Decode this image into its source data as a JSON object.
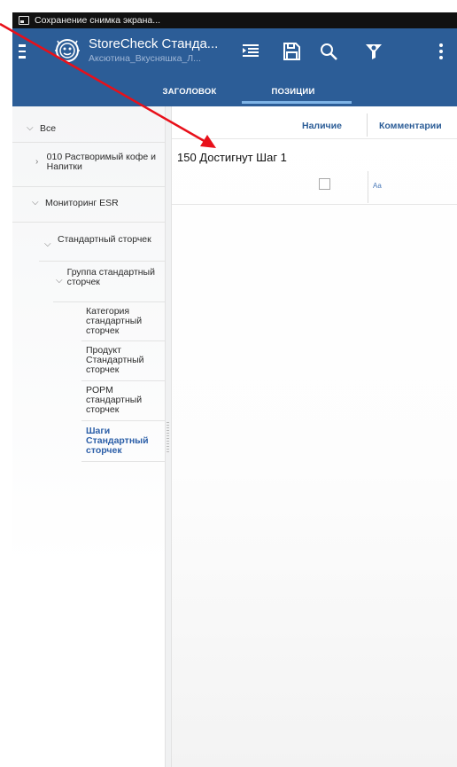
{
  "statusbar": {
    "text": "Сохранение снимка экрана..."
  },
  "appbar": {
    "title": "StoreCheck Станда...",
    "subtitle": "Аксютина_Вкусняшка_Л...",
    "icons": [
      "menu-icon",
      "logo-icon",
      "list-icon",
      "save-icon",
      "search-icon",
      "filter-icon",
      "more-icon"
    ]
  },
  "tabs": [
    {
      "label": "ЗАГОЛОВОК"
    },
    {
      "label": "ПОЗИЦИИ"
    }
  ],
  "sidebar": {
    "items": [
      {
        "label": "Все",
        "chevron": "down"
      },
      {
        "label": "010 Растворимый кофе и Напитки",
        "chevron": "right"
      },
      {
        "label": "Мониторинг ESR",
        "chevron": "down"
      },
      {
        "label": "Стандартный сторчек",
        "chevron": "down"
      },
      {
        "label": "Группа стандартный сторчек",
        "chevron": "down"
      },
      {
        "label": "Категория стандартный сторчек"
      },
      {
        "label": "Продукт Стандартный сторчек"
      },
      {
        "label": "POPM стандартный сторчек"
      },
      {
        "label": "Шаги Стандартный сторчек",
        "active": true
      }
    ]
  },
  "main": {
    "columns": [
      "Наличие",
      "Комментарии"
    ],
    "row_title": "150 Достигнут Шаг 1",
    "text_icon": "Aa"
  },
  "colors": {
    "appbar": "#2c5d97",
    "tab_indicator": "#7fb4e6",
    "accent_text": "#2c5fa8",
    "arrow": "#e8101a"
  }
}
